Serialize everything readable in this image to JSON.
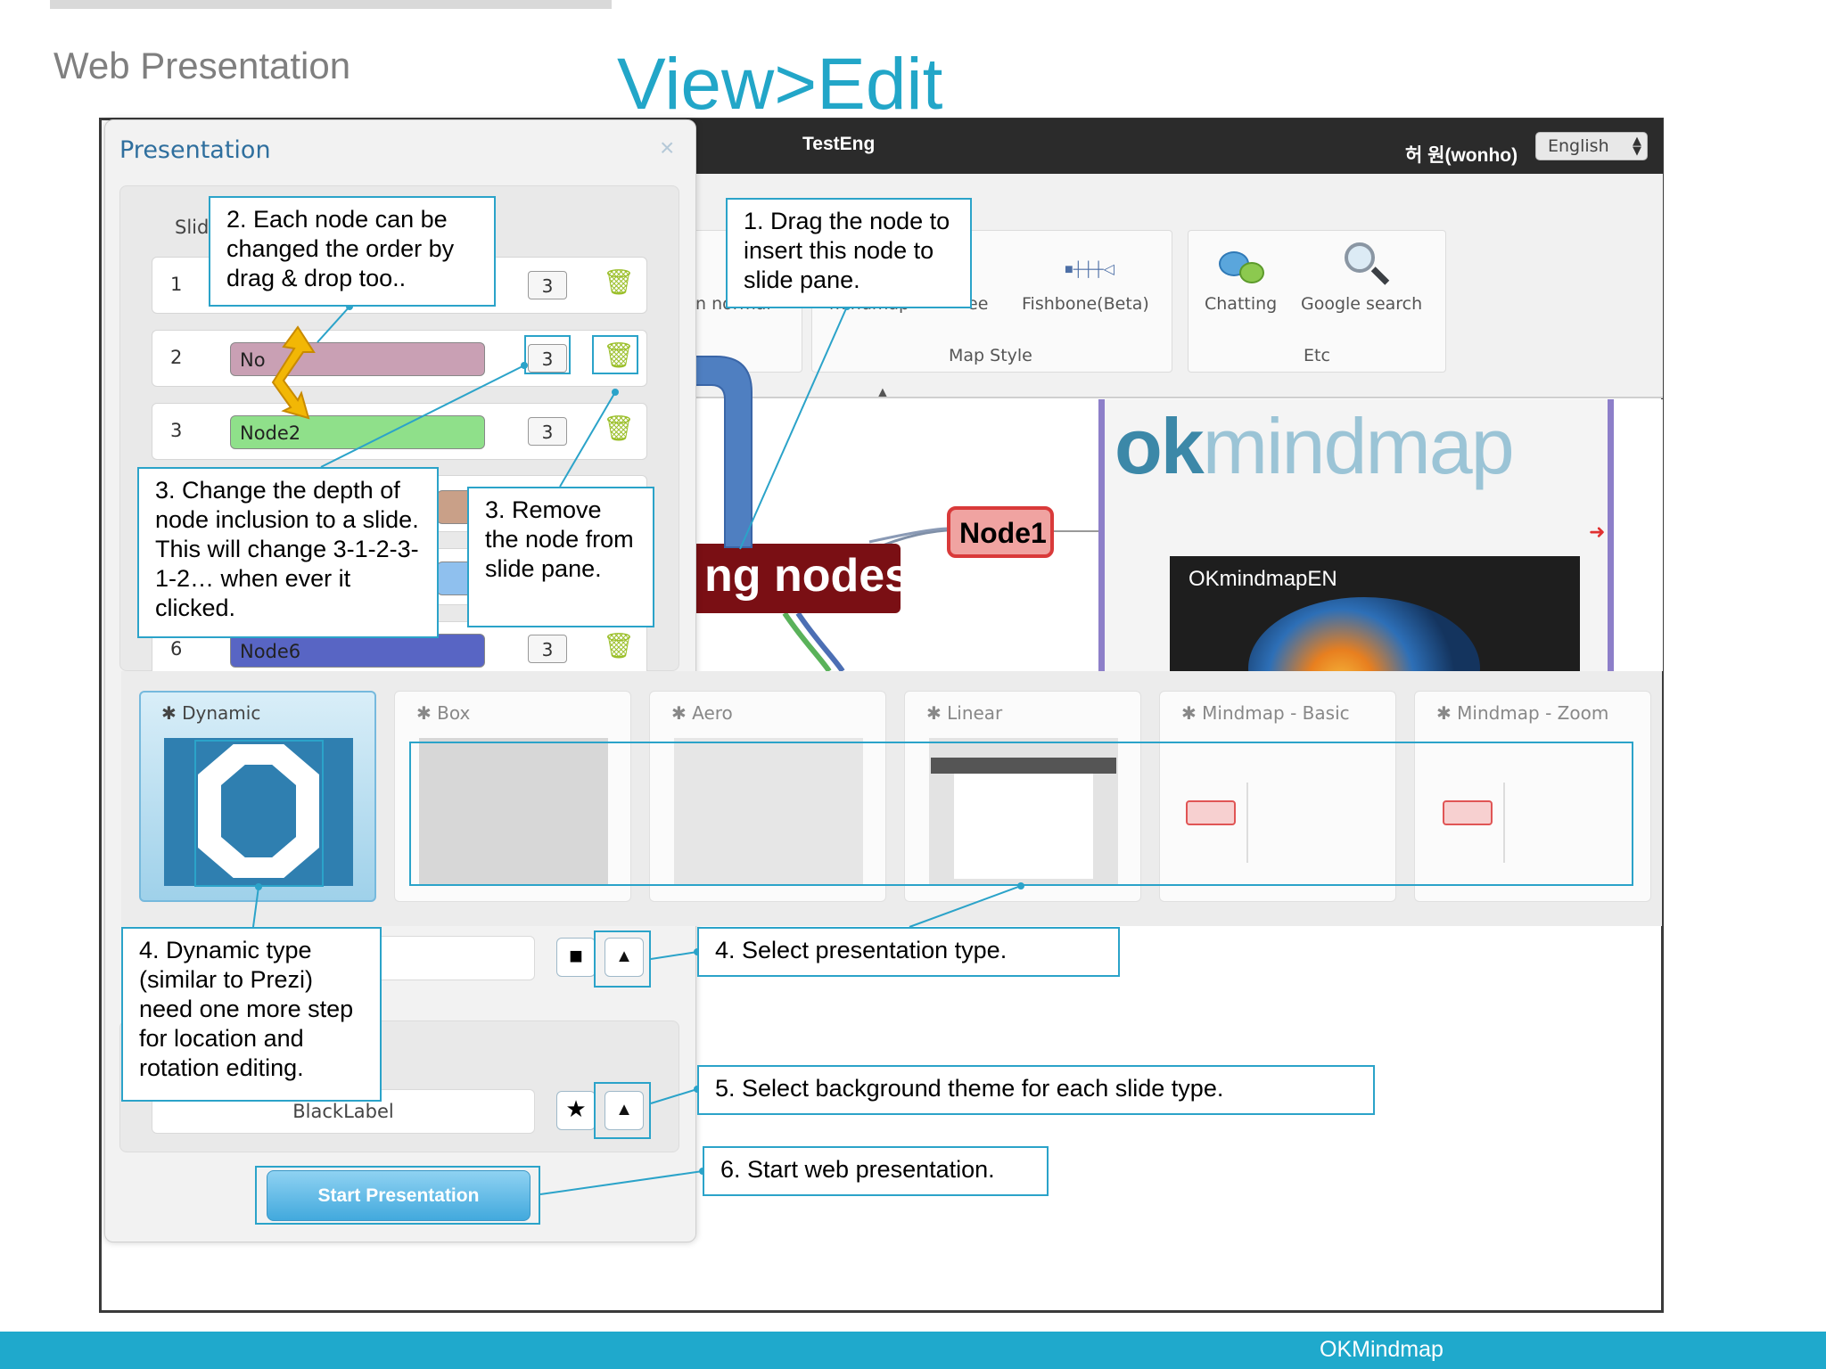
{
  "slide": {
    "heading": "Web Presentation",
    "title": "View>Edit",
    "footer": "OKMindmap"
  },
  "app": {
    "title": "TestEng",
    "user": "허 원(wonho)",
    "language": "English",
    "toolbar": {
      "partial_left_label": "n normal",
      "partial_mid_label": "mindmap",
      "partial_tree_label": "ee",
      "fishbone_label": "Fishbone(Beta)",
      "chatting_label": "Chatting",
      "google_label": "Google search",
      "group_map_style": "Map Style",
      "group_etc": "Etc"
    },
    "canvas": {
      "big_node": "ng nodes",
      "node1": "Node1",
      "logo_ok": "ok",
      "logo_rest": "mindmap",
      "preview_title": "OKmindmapEN"
    }
  },
  "dialog": {
    "title": "Presentation",
    "close": "×",
    "slides_header": "Slid",
    "rows": [
      {
        "num": "1",
        "node": "",
        "depth": "3",
        "color": "#ffffff"
      },
      {
        "num": "2",
        "node": "No",
        "depth": "3",
        "color": "#c9a0b4"
      },
      {
        "num": "3",
        "node": "Node2",
        "depth": "3",
        "color": "#8fe08a"
      },
      {
        "num": "6",
        "node": "Node6",
        "depth": "3",
        "color": "#5865c4"
      }
    ],
    "types": [
      {
        "name": "Dynamic",
        "active": true
      },
      {
        "name": "Box",
        "active": false
      },
      {
        "name": "Aero",
        "active": false
      },
      {
        "name": "Linear",
        "active": false
      },
      {
        "name": "Mindmap - Basic",
        "active": false
      },
      {
        "name": "Mindmap - Zoom",
        "active": false
      }
    ],
    "bg_theme": "BlackLabel",
    "start_button": "Start Presentation"
  },
  "callouts": {
    "c1": "1. Drag the node to insert this node to slide pane.",
    "c2": "2. Each node can be changed the order by drag & drop too..",
    "c3a": "3. Change the depth of node inclusion to a slide. This will change 3-1-2-3-1-2… when ever it clicked.",
    "c3b": "3. Remove the node from slide pane.",
    "c4a": "4. Dynamic type (similar to Prezi) need one more step for location and rotation editing.",
    "c4b": "4. Select presentation type.",
    "c5": "5. Select background theme for each slide type.",
    "c6": "6. Start web presentation."
  },
  "colors": {
    "accent": "#22a6c8",
    "callout_border": "#2ba3c9",
    "footer": "#1fa9cc",
    "big_arrow": "#4f7fc1",
    "yellow_arrow": "#f2b705"
  },
  "icons": {
    "trash": "trash-icon",
    "cube": "cube-icon",
    "screen": "presentation-screen-icon",
    "chat": "chat-bubbles-icon",
    "search": "magnifier-icon"
  }
}
